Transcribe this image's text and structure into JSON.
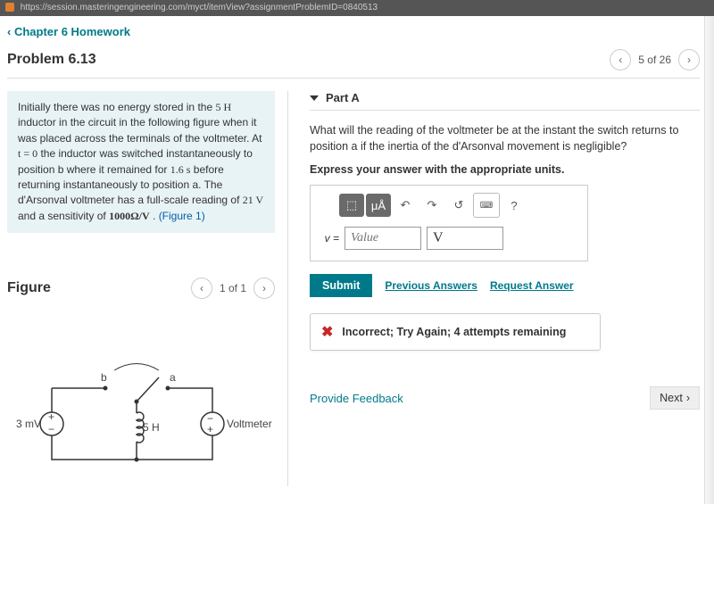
{
  "url": "https://session.masteringengineering.com/myct/itemView?assignmentProblemID=0840513",
  "breadcrumb": "Chapter 6 Homework",
  "chevron": "‹",
  "problem_title": "Problem 6.13",
  "nav": {
    "prev": "‹",
    "next": "›",
    "position": "5 of 26"
  },
  "prompt": {
    "t1": "Initially there was no energy stored in the ",
    "v1": "5 H",
    "t2": " inductor in the circuit in the following figure when it was placed across the terminals of the voltmeter. At ",
    "v2": "t = 0",
    "t3": " the inductor was switched instantaneously to position b where it remained for ",
    "v3": "1.6 s",
    "t4": " before returning instantaneously to position a. The d'Arsonval voltmeter has a full-scale reading of ",
    "v4": "21 V",
    "t5": " and a sensitivity of ",
    "v5": "1000Ω/V",
    "t6": ". ",
    "fig_link": "(Figure 1)"
  },
  "figure": {
    "title": "Figure",
    "nav": {
      "prev": "‹",
      "next": "›",
      "position": "1 of 1"
    },
    "labels": {
      "b": "b",
      "a": "a",
      "src": "3 mV",
      "ind": "5 H",
      "vm": "Voltmeter"
    }
  },
  "partA": {
    "title": "Part A",
    "question": "What will the reading of the voltmeter be at the instant the switch returns to position a if the inertia of the d'Arsonval movement is negligible?",
    "instruct": "Express your answer with the appropriate units.",
    "toolbar": {
      "templates": "⬚",
      "units": "μÅ",
      "undo": "↶",
      "redo": "↷",
      "reset": "↺",
      "keyboard": "⌨",
      "help": "?"
    },
    "answer": {
      "vlabel": "v =",
      "value_placeholder": "Value",
      "unit_value": "V"
    },
    "submit": "Submit",
    "prev_answers": "Previous Answers",
    "request_answer": "Request Answer",
    "feedback": "Incorrect; Try Again; 4 attempts remaining"
  },
  "footer": {
    "provide_feedback": "Provide Feedback",
    "next": "Next"
  }
}
